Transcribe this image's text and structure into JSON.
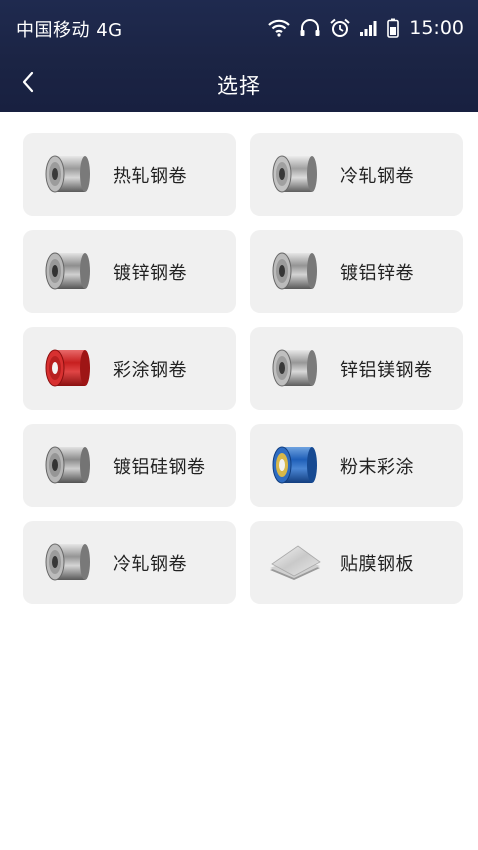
{
  "status_bar": {
    "carrier": "中国移动 4G",
    "time": "15:00",
    "icons": [
      "wifi-icon",
      "headphones-icon",
      "alarm-icon",
      "signal-icon",
      "battery-icon"
    ]
  },
  "nav": {
    "title": "选择",
    "back_icon": "chevron-left-icon"
  },
  "colors": {
    "header_bg": "#1d2646",
    "tile_bg": "#f0f0f0",
    "page_bg": "#ffffff"
  },
  "items": [
    {
      "label": "热轧钢卷",
      "icon": "steel-coil-icon"
    },
    {
      "label": "冷轧钢卷",
      "icon": "steel-coil-icon"
    },
    {
      "label": "镀锌钢卷",
      "icon": "steel-coil-icon"
    },
    {
      "label": "镀铝锌卷",
      "icon": "steel-coil-icon"
    },
    {
      "label": "彩涂钢卷",
      "icon": "red-steel-coil-icon"
    },
    {
      "label": "锌铝镁钢卷",
      "icon": "steel-coil-icon"
    },
    {
      "label": "镀铝硅钢卷",
      "icon": "steel-coil-icon"
    },
    {
      "label": "粉末彩涂",
      "icon": "blue-steel-coil-icon"
    },
    {
      "label": "冷轧钢卷",
      "icon": "steel-coil-icon"
    },
    {
      "label": "贴膜钢板",
      "icon": "steel-sheet-icon"
    }
  ]
}
